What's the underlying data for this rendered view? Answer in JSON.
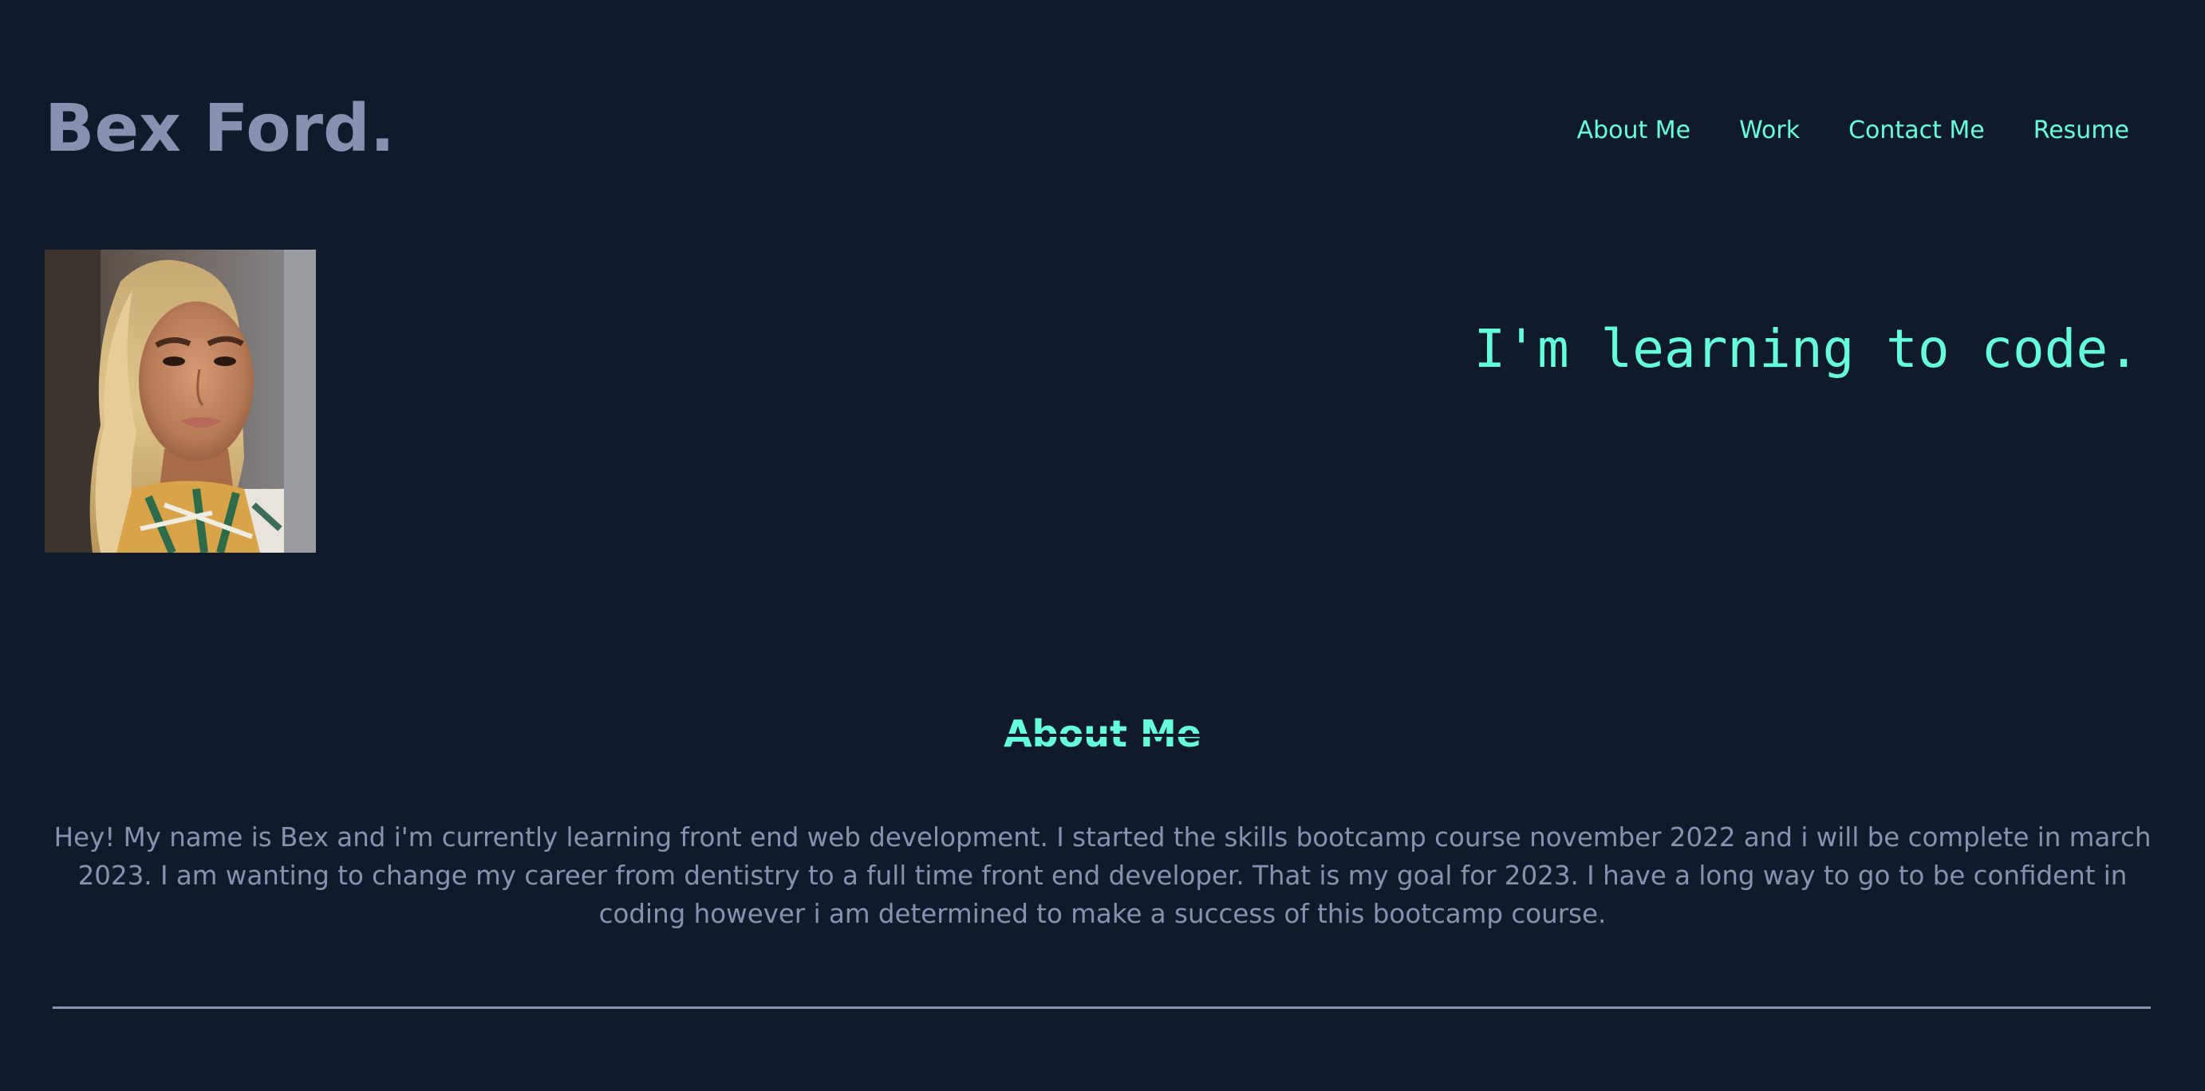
{
  "header": {
    "brand": "Bex Ford.",
    "nav": [
      "About Me",
      "Work",
      "Contact Me",
      "Resume"
    ]
  },
  "hero": {
    "tagline": "I'm learning to code."
  },
  "about": {
    "heading": "About Me",
    "body": "Hey! My name is Bex and i'm currently learning front end web development. I started the skills bootcamp course november 2022 and i will be complete in march 2023. I am wanting to change my career from dentistry to a full time front end developer. That is my goal for 2023. I have a long way to go to be confident in coding however i am determined to make a success of this bootcamp course."
  },
  "colors": {
    "background": "#0f1b2d",
    "accent": "#64ffda",
    "muted": "#8892b0"
  }
}
